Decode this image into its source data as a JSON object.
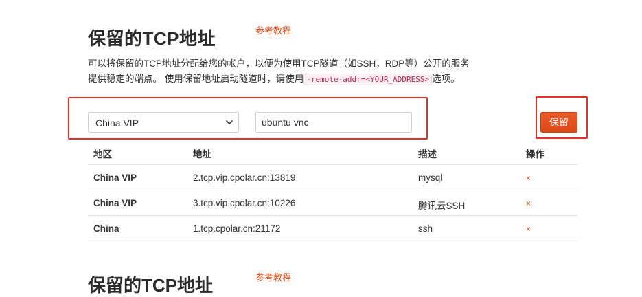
{
  "section": {
    "title": "保留的TCP地址",
    "ref_link": "参考教程",
    "desc_line1": "可以将保留的TCP地址分配给您的帐户，以便为使用TCP隧道（如SSH，RDP等）公开的服务",
    "desc_line2_prefix": "提供稳定的端点。 使用保留地址启动隧道时，请使用",
    "desc_code": "-remote-addr=<YOUR_ADDRESS>",
    "desc_line2_suffix": "选项。"
  },
  "form": {
    "region_selected": "China VIP",
    "description_value": "ubuntu vnc",
    "save_label": "保留"
  },
  "table": {
    "headers": {
      "region": "地区",
      "address": "地址",
      "description": "描述",
      "actions": "操作"
    },
    "rows": [
      {
        "region": "China VIP",
        "address": "2.tcp.vip.cpolar.cn:13819",
        "description": "mysql",
        "delete": "×"
      },
      {
        "region": "China VIP",
        "address": "3.tcp.vip.cpolar.cn:10226",
        "description": "腾讯云SSH",
        "delete": "×"
      },
      {
        "region": "China",
        "address": "1.tcp.cpolar.cn:21172",
        "description": "ssh",
        "delete": "×"
      }
    ]
  },
  "next_section": {
    "title": "保留的TCP地址",
    "ref_link": "参考教程"
  },
  "colors": {
    "accent": "#dd4814",
    "highlight_box": "#e5302d"
  },
  "icons": {
    "select_arrow": "chevron-down-icon",
    "delete": "close-icon"
  }
}
